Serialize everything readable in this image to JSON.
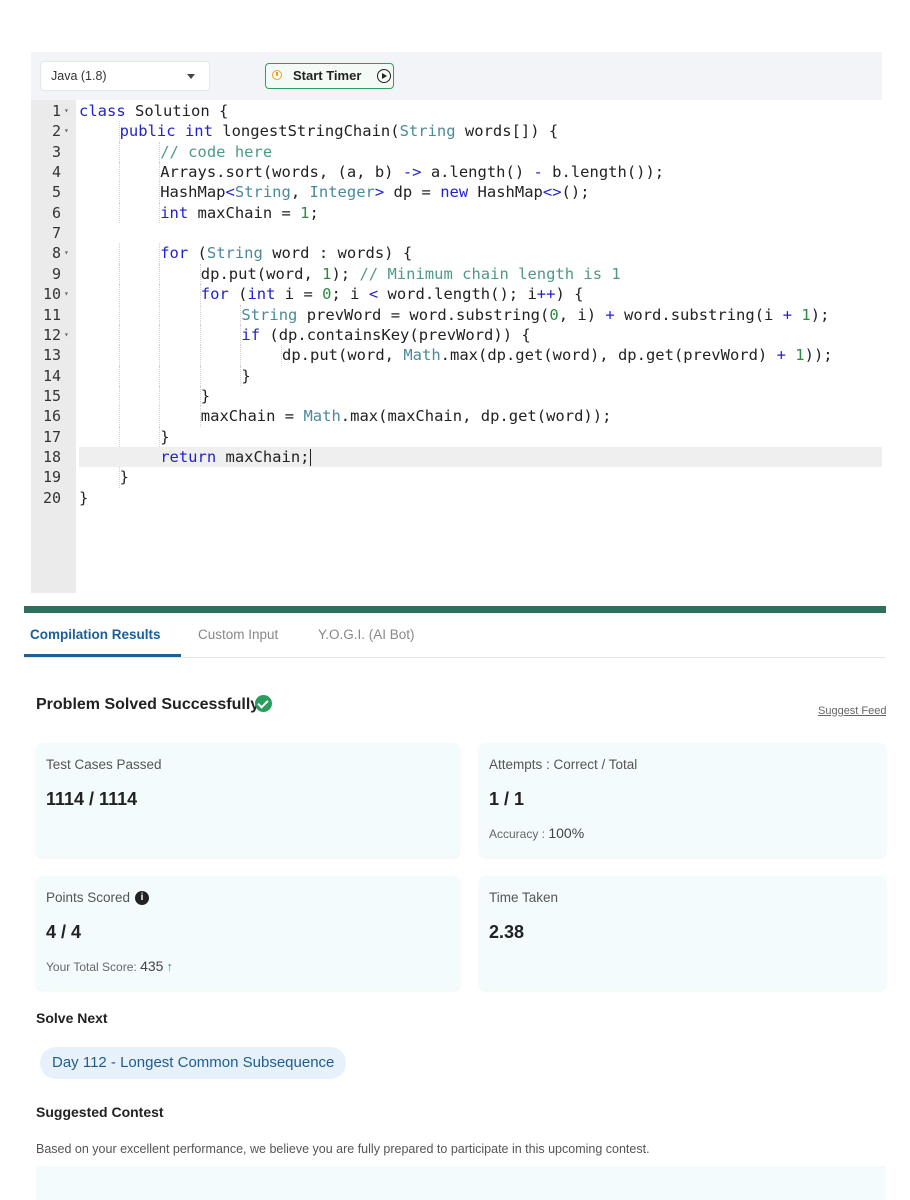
{
  "editor": {
    "language": "Java (1.8)",
    "timer_label": "Start Timer",
    "lines": [
      {
        "n": "1",
        "fold": true,
        "indent": 0,
        "tokens": [
          [
            "k",
            "class"
          ],
          [
            "p",
            " Solution {"
          ]
        ]
      },
      {
        "n": "2",
        "fold": true,
        "indent": 1,
        "tokens": [
          [
            "k",
            "public"
          ],
          [
            "p",
            " "
          ],
          [
            "k",
            "int"
          ],
          [
            "p",
            " longestStringChain("
          ],
          [
            "t",
            "String"
          ],
          [
            "p",
            " words[]) {"
          ]
        ]
      },
      {
        "n": "3",
        "fold": false,
        "indent": 2,
        "tokens": [
          [
            "c",
            "// code here"
          ]
        ]
      },
      {
        "n": "4",
        "fold": false,
        "indent": 2,
        "tokens": [
          [
            "p",
            "Arrays.sort(words, (a, b) "
          ],
          [
            "k",
            "->"
          ],
          [
            "p",
            " a.length() "
          ],
          [
            "k",
            "-"
          ],
          [
            "p",
            " b.length());"
          ]
        ]
      },
      {
        "n": "5",
        "fold": false,
        "indent": 2,
        "tokens": [
          [
            "p",
            "HashMap"
          ],
          [
            "k",
            "<"
          ],
          [
            "t",
            "String"
          ],
          [
            "p",
            ", "
          ],
          [
            "t",
            "Integer"
          ],
          [
            "k",
            ">"
          ],
          [
            "p",
            " dp = "
          ],
          [
            "k",
            "new"
          ],
          [
            "p",
            " HashMap"
          ],
          [
            "k",
            "<>"
          ],
          [
            "p",
            "();"
          ]
        ]
      },
      {
        "n": "6",
        "fold": false,
        "indent": 2,
        "tokens": [
          [
            "k",
            "int"
          ],
          [
            "p",
            " maxChain = "
          ],
          [
            "n",
            "1"
          ],
          [
            "p",
            ";"
          ]
        ]
      },
      {
        "n": "7",
        "fold": false,
        "indent": 0,
        "tokens": []
      },
      {
        "n": "8",
        "fold": true,
        "indent": 2,
        "tokens": [
          [
            "k",
            "for"
          ],
          [
            "p",
            " ("
          ],
          [
            "t",
            "String"
          ],
          [
            "p",
            " word : words) {"
          ]
        ]
      },
      {
        "n": "9",
        "fold": false,
        "indent": 3,
        "tokens": [
          [
            "p",
            "dp.put(word, "
          ],
          [
            "n",
            "1"
          ],
          [
            "p",
            "); "
          ],
          [
            "c",
            "// Minimum chain length is 1"
          ]
        ]
      },
      {
        "n": "10",
        "fold": true,
        "indent": 3,
        "tokens": [
          [
            "k",
            "for"
          ],
          [
            "p",
            " ("
          ],
          [
            "k",
            "int"
          ],
          [
            "p",
            " i = "
          ],
          [
            "n",
            "0"
          ],
          [
            "p",
            "; i "
          ],
          [
            "k",
            "<"
          ],
          [
            "p",
            " word.length(); i"
          ],
          [
            "k",
            "++"
          ],
          [
            "p",
            ") {"
          ]
        ]
      },
      {
        "n": "11",
        "fold": false,
        "indent": 4,
        "tokens": [
          [
            "t",
            "String"
          ],
          [
            "p",
            " prevWord = word.substring("
          ],
          [
            "n",
            "0"
          ],
          [
            "p",
            ", i) "
          ],
          [
            "k",
            "+"
          ],
          [
            "p",
            " word.substring(i "
          ],
          [
            "k",
            "+"
          ],
          [
            "p",
            " "
          ],
          [
            "n",
            "1"
          ],
          [
            "p",
            ");"
          ]
        ]
      },
      {
        "n": "12",
        "fold": true,
        "indent": 4,
        "tokens": [
          [
            "k",
            "if"
          ],
          [
            "p",
            " (dp.containsKey(prevWord)) {"
          ]
        ]
      },
      {
        "n": "13",
        "fold": false,
        "indent": 5,
        "tokens": [
          [
            "p",
            "dp.put(word, "
          ],
          [
            "t",
            "Math"
          ],
          [
            "p",
            ".max(dp.get(word), dp.get(prevWord) "
          ],
          [
            "k",
            "+"
          ],
          [
            "p",
            " "
          ],
          [
            "n",
            "1"
          ],
          [
            "p",
            "));"
          ]
        ]
      },
      {
        "n": "14",
        "fold": false,
        "indent": 4,
        "tokens": [
          [
            "p",
            "}"
          ]
        ]
      },
      {
        "n": "15",
        "fold": false,
        "indent": 3,
        "tokens": [
          [
            "p",
            "}"
          ]
        ]
      },
      {
        "n": "16",
        "fold": false,
        "indent": 3,
        "tokens": [
          [
            "p",
            "maxChain = "
          ],
          [
            "t",
            "Math"
          ],
          [
            "p",
            ".max(maxChain, dp.get(word));"
          ]
        ]
      },
      {
        "n": "17",
        "fold": false,
        "indent": 2,
        "tokens": [
          [
            "p",
            "}"
          ]
        ]
      },
      {
        "n": "18",
        "fold": false,
        "indent": 2,
        "active": true,
        "tokens": [
          [
            "k",
            "return"
          ],
          [
            "p",
            " maxChain;"
          ]
        ]
      },
      {
        "n": "19",
        "fold": false,
        "indent": 1,
        "tokens": [
          [
            "p",
            "}"
          ]
        ]
      },
      {
        "n": "20",
        "fold": false,
        "indent": 0,
        "tokens": [
          [
            "p",
            "}"
          ]
        ]
      }
    ]
  },
  "tabs": [
    "Compilation Results",
    "Custom Input",
    "Y.O.G.I. (AI Bot)"
  ],
  "result": {
    "title": "Problem Solved Successfully",
    "feedback": "Suggest Feedback"
  },
  "cards": {
    "tests": {
      "label": "Test Cases Passed",
      "value": "1114 / 1114"
    },
    "attempts": {
      "label": "Attempts : Correct / Total",
      "value": "1 / 1",
      "accuracy_label": "Accuracy :",
      "accuracy_value": "100%"
    },
    "points": {
      "label": "Points Scored",
      "value": "4 / 4",
      "total_label": "Your Total Score:",
      "total_value": "435"
    },
    "time": {
      "label": "Time Taken",
      "value": "2.38"
    }
  },
  "solve_next": {
    "title": "Solve Next",
    "problem": "Day 112 - Longest Common Subsequence"
  },
  "contest": {
    "title": "Suggested Contest",
    "description": "Based on your excellent performance, we believe you are fully prepared to participate in this upcoming contest."
  },
  "colors": {
    "accent": "#1a5f9a",
    "success": "#2a9d5e",
    "divider": "#2e6f5e"
  }
}
